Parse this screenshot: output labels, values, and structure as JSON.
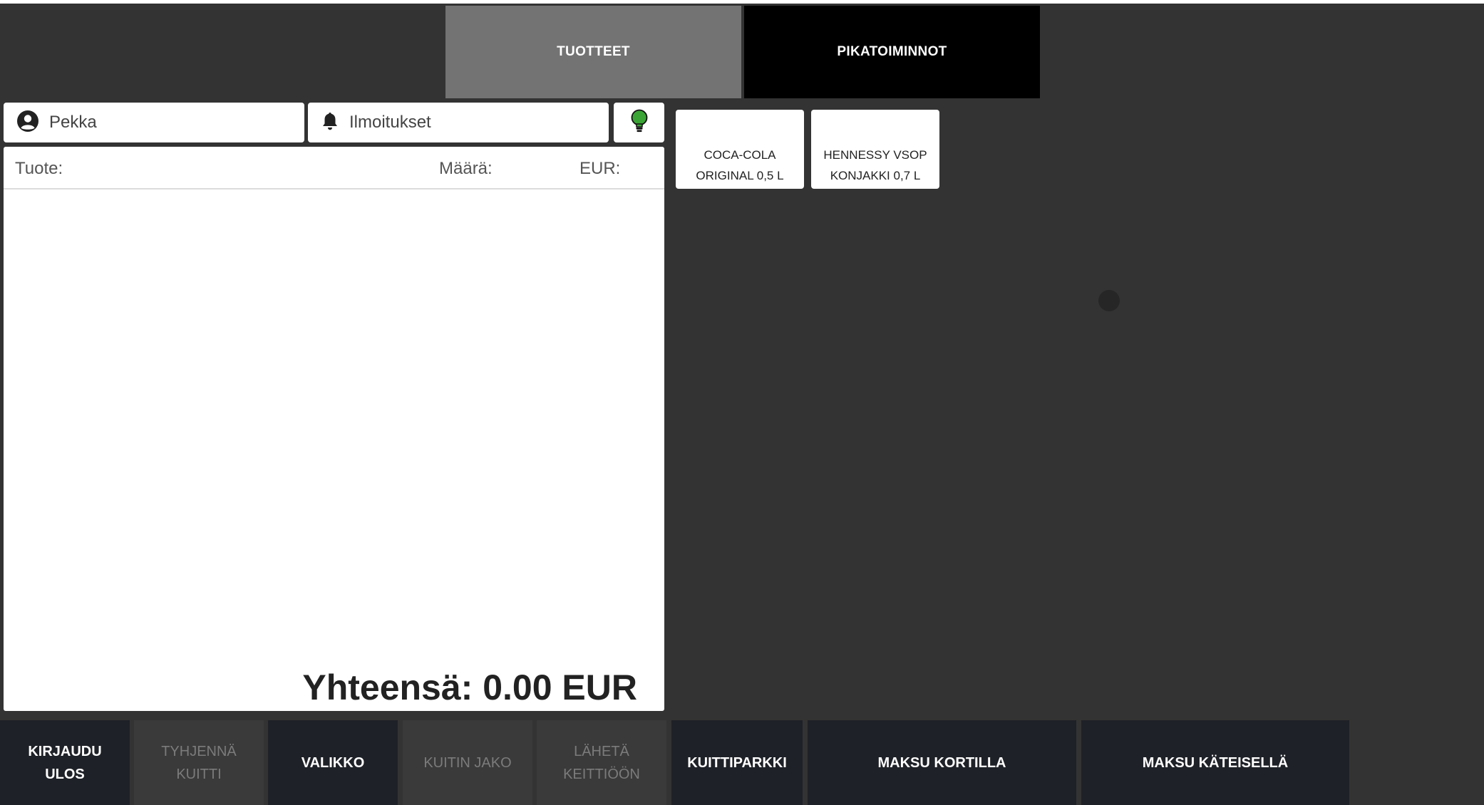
{
  "tabs": {
    "products": "TUOTTEET",
    "quick_actions": "PIKATOIMINNOT"
  },
  "user": {
    "name": "Pekka",
    "icon": "user-circle-icon"
  },
  "notifications": {
    "label": "Ilmoitukset",
    "icon": "bell-icon"
  },
  "status_indicator": {
    "icon": "lightbulb-icon",
    "color": "#3aa435"
  },
  "receipt": {
    "col_product": "Tuote:",
    "col_quantity": "Määrä:",
    "col_eur": "EUR:",
    "total": "Yhteensä: 0.00 EUR"
  },
  "products": [
    {
      "line1": "COCA-COLA",
      "line2": "ORIGINAL 0,5 L"
    },
    {
      "line1": "HENNESSY VSOP",
      "line2": "KONJAKKI 0,7 L"
    }
  ],
  "bottom_bar": {
    "logout": {
      "line1": "KIRJAUDU",
      "line2": "ULOS"
    },
    "clear_receipt": {
      "line1": "TYHJENNÄ",
      "line2": "KUITTI"
    },
    "menu": "VALIKKO",
    "split_receipt": "KUITIN JAKO",
    "send_kitchen": {
      "line1": "LÄHETÄ",
      "line2": "KEITTIÖÖN"
    },
    "receipt_park": "KUITTIPARKKI",
    "pay_card": "MAKSU KORTILLA",
    "pay_cash": "MAKSU KÄTEISELLÄ"
  },
  "colors": {
    "background": "#333333",
    "active_tab": "#737373",
    "inactive_tab": "#000000",
    "button": "#1e2127",
    "button_disabled": "#3a3a3a"
  }
}
